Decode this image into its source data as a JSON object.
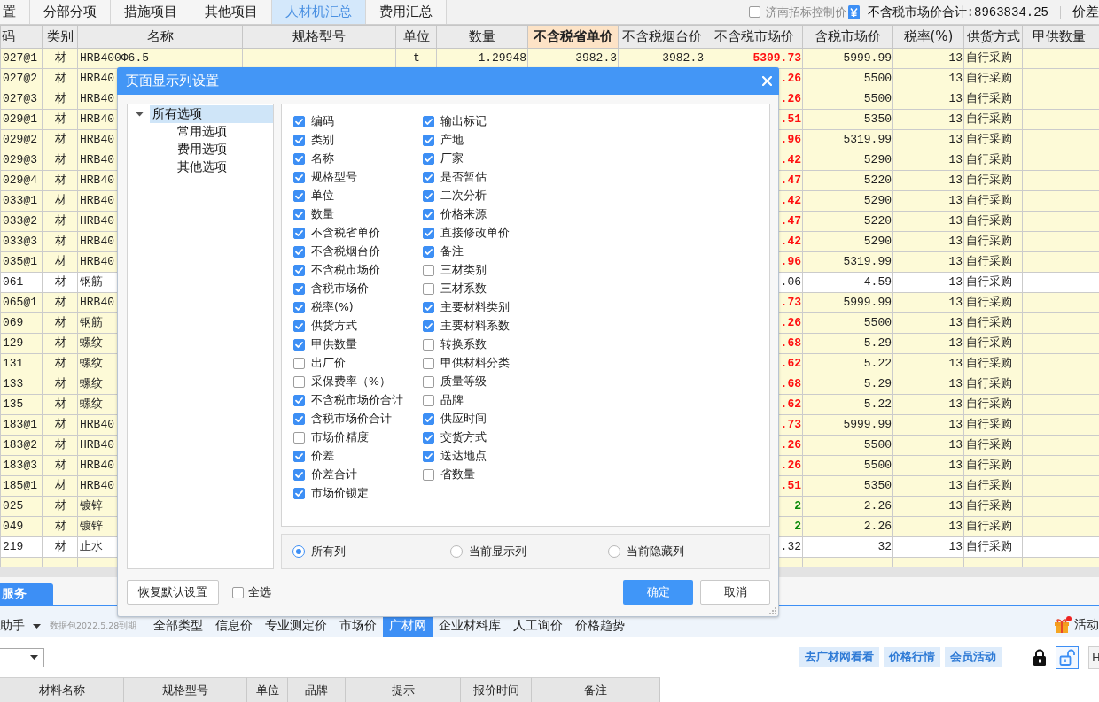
{
  "top_tabs": [
    {
      "label": "置",
      "selected": false
    },
    {
      "label": "分部分项",
      "selected": false
    },
    {
      "label": "措施项目",
      "selected": false
    },
    {
      "label": "其他项目",
      "selected": false
    },
    {
      "label": "人材机汇总",
      "selected": true
    },
    {
      "label": "费用汇总",
      "selected": false
    }
  ],
  "price_control": {
    "label": "济南招标控制价",
    "checked": false
  },
  "market_total": "不含税市场价合计:8963834.25",
  "price_diff": "价差",
  "table": {
    "columns": [
      {
        "label": "码",
        "highlighted": false
      },
      {
        "label": "类别",
        "highlighted": false
      },
      {
        "label": "名称",
        "highlighted": false
      },
      {
        "label": "规格型号",
        "highlighted": false
      },
      {
        "label": "单位",
        "highlighted": false
      },
      {
        "label": "数量",
        "highlighted": false
      },
      {
        "label": "不含税省单价",
        "highlighted": true
      },
      {
        "label": "不含税烟台价",
        "highlighted": false
      },
      {
        "label": "不含税市场价",
        "highlighted": false
      },
      {
        "label": "含税市场价",
        "highlighted": false
      },
      {
        "label": "税率(%)",
        "highlighted": false
      },
      {
        "label": "供货方式",
        "highlighted": false
      },
      {
        "label": "甲供数量",
        "highlighted": false
      }
    ],
    "rows": [
      {
        "kind": "raised",
        "highlighted": true,
        "code": "027@1",
        "type": "材",
        "name": "HRB400Φ6.5",
        "unit": "t",
        "quantity": "1.29948",
        "provincial_price": "3982.3",
        "yantai_price": "3982.3",
        "market_price": "5309.73",
        "market_price_tax": "5999.99",
        "tax_rate": "13",
        "supply": "自行采购"
      },
      {
        "kind": "raised",
        "highlighted": true,
        "code": "027@2",
        "type": "材",
        "name": "HRB40",
        "market_price": ".26",
        "market_price_tax": "5500",
        "tax_rate": "13",
        "supply": "自行采购"
      },
      {
        "kind": "raised",
        "highlighted": true,
        "code": "027@3",
        "type": "材",
        "name": "HRB40",
        "market_price": ".26",
        "market_price_tax": "5500",
        "tax_rate": "13",
        "supply": "自行采购"
      },
      {
        "kind": "raised",
        "highlighted": true,
        "code": "029@1",
        "type": "材",
        "name": "HRB40",
        "market_price": ".51",
        "market_price_tax": "5350",
        "tax_rate": "13",
        "supply": "自行采购"
      },
      {
        "kind": "raised",
        "highlighted": true,
        "code": "029@2",
        "type": "材",
        "name": "HRB40",
        "market_price": ".96",
        "market_price_tax": "5319.99",
        "tax_rate": "13",
        "supply": "自行采购"
      },
      {
        "kind": "raised",
        "highlighted": true,
        "code": "029@3",
        "type": "材",
        "name": "HRB40",
        "market_price": ".42",
        "market_price_tax": "5290",
        "tax_rate": "13",
        "supply": "自行采购"
      },
      {
        "kind": "raised",
        "highlighted": true,
        "code": "029@4",
        "type": "材",
        "name": "HRB40",
        "market_price": ".47",
        "market_price_tax": "5220",
        "tax_rate": "13",
        "supply": "自行采购"
      },
      {
        "kind": "raised",
        "highlighted": true,
        "code": "033@1",
        "type": "材",
        "name": "HRB40",
        "market_price": ".42",
        "market_price_tax": "5290",
        "tax_rate": "13",
        "supply": "自行采购"
      },
      {
        "kind": "raised",
        "highlighted": true,
        "code": "033@2",
        "type": "材",
        "name": "HRB40",
        "market_price": ".47",
        "market_price_tax": "5220",
        "tax_rate": "13",
        "supply": "自行采购"
      },
      {
        "kind": "raised",
        "highlighted": true,
        "code": "033@3",
        "type": "材",
        "name": "HRB40",
        "market_price": ".42",
        "market_price_tax": "5290",
        "tax_rate": "13",
        "supply": "自行采购"
      },
      {
        "kind": "raised",
        "highlighted": true,
        "code": "035@1",
        "type": "材",
        "name": "HRB40",
        "market_price": ".96",
        "market_price_tax": "5319.99",
        "tax_rate": "13",
        "supply": "自行采购"
      },
      {
        "kind": "unchanged",
        "highlighted": false,
        "code": "061",
        "type": "材",
        "name": "钢筋",
        "market_price": ".06",
        "market_price_tax": "4.59",
        "tax_rate": "13",
        "supply": "自行采购"
      },
      {
        "kind": "raised",
        "highlighted": true,
        "code": "065@1",
        "type": "材",
        "name": "HRB40",
        "market_price": ".73",
        "market_price_tax": "5999.99",
        "tax_rate": "13",
        "supply": "自行采购"
      },
      {
        "kind": "raised",
        "highlighted": true,
        "code": "069",
        "type": "材",
        "name": "钢筋",
        "market_price": ".26",
        "market_price_tax": "5500",
        "tax_rate": "13",
        "supply": "自行采购"
      },
      {
        "kind": "raised",
        "highlighted": true,
        "code": "129",
        "type": "材",
        "name": "螺纹",
        "market_price": ".68",
        "market_price_tax": "5.29",
        "tax_rate": "13",
        "supply": "自行采购"
      },
      {
        "kind": "raised",
        "highlighted": true,
        "code": "131",
        "type": "材",
        "name": "螺纹",
        "market_price": ".62",
        "market_price_tax": "5.22",
        "tax_rate": "13",
        "supply": "自行采购"
      },
      {
        "kind": "raised",
        "highlighted": true,
        "code": "133",
        "type": "材",
        "name": "螺纹",
        "market_price": ".68",
        "market_price_tax": "5.29",
        "tax_rate": "13",
        "supply": "自行采购"
      },
      {
        "kind": "raised",
        "highlighted": true,
        "code": "135",
        "type": "材",
        "name": "螺纹",
        "market_price": ".62",
        "market_price_tax": "5.22",
        "tax_rate": "13",
        "supply": "自行采购"
      },
      {
        "kind": "raised",
        "highlighted": true,
        "code": "183@1",
        "type": "材",
        "name": "HRB40",
        "market_price": ".73",
        "market_price_tax": "5999.99",
        "tax_rate": "13",
        "supply": "自行采购"
      },
      {
        "kind": "raised",
        "highlighted": true,
        "code": "183@2",
        "type": "材",
        "name": "HRB40",
        "market_price": ".26",
        "market_price_tax": "5500",
        "tax_rate": "13",
        "supply": "自行采购"
      },
      {
        "kind": "raised",
        "highlighted": true,
        "code": "183@3",
        "type": "材",
        "name": "HRB40",
        "market_price": ".26",
        "market_price_tax": "5500",
        "tax_rate": "13",
        "supply": "自行采购"
      },
      {
        "kind": "raised",
        "highlighted": true,
        "code": "185@1",
        "type": "材",
        "name": "HRB40",
        "market_price": ".51",
        "market_price_tax": "5350",
        "tax_rate": "13",
        "supply": "自行采购"
      },
      {
        "kind": "lowered",
        "highlighted": true,
        "code": "025",
        "type": "材",
        "name": "镀锌",
        "market_price": "2",
        "market_price_tax": "2.26",
        "tax_rate": "13",
        "supply": "自行采购"
      },
      {
        "kind": "lowered",
        "highlighted": true,
        "code": "049",
        "type": "材",
        "name": "镀锌",
        "market_price": "2",
        "market_price_tax": "2.26",
        "tax_rate": "13",
        "supply": "自行采购"
      },
      {
        "kind": "unchanged",
        "highlighted": false,
        "code": "219",
        "type": "材",
        "name": "止水",
        "market_price": ".32",
        "market_price_tax": "32",
        "tax_rate": "13",
        "supply": "自行采购"
      }
    ]
  },
  "bottom_tabs": [
    {
      "label": "服务",
      "selected": true
    }
  ],
  "assistant": {
    "label": "助手",
    "data_expiry": "数据包2022.5.28到期"
  },
  "source_tabs": [
    {
      "label": "全部类型",
      "selected": false
    },
    {
      "label": "信息价",
      "selected": false
    },
    {
      "label": "专业测定价",
      "selected": false
    },
    {
      "label": "市场价",
      "selected": false
    },
    {
      "label": "广材网",
      "selected": true
    },
    {
      "label": "企业材料库",
      "selected": false
    },
    {
      "label": "人工询价",
      "selected": false
    },
    {
      "label": "价格趋势",
      "selected": false
    }
  ],
  "activity": "活动",
  "action_buttons": [
    "去广材网看看",
    "价格行情",
    "会员活动"
  ],
  "lock_modes": [
    {
      "kind": "locked",
      "selected": false
    },
    {
      "kind": "unlocked",
      "selected": true
    }
  ],
  "h_button": "H",
  "lower_table": {
    "columns": [
      "材料名称",
      "规格型号",
      "单位",
      "品牌",
      "提示",
      "报价时间",
      "备注"
    ]
  },
  "dialog": {
    "title": "页面显示列设置",
    "tree": [
      {
        "label": "所有选项",
        "expanded": true,
        "selected": true,
        "children": [
          {
            "label": "常用选项",
            "selected": false
          },
          {
            "label": "费用选项",
            "selected": false
          },
          {
            "label": "其他选项",
            "selected": false
          }
        ]
      }
    ],
    "option_columns": [
      [
        {
          "label": "编码",
          "checked": true
        },
        {
          "label": "类别",
          "checked": true
        },
        {
          "label": "名称",
          "checked": true
        },
        {
          "label": "规格型号",
          "checked": true
        },
        {
          "label": "单位",
          "checked": true
        },
        {
          "label": "数量",
          "checked": true
        },
        {
          "label": "不含税省单价",
          "checked": true
        },
        {
          "label": "不含税烟台价",
          "checked": true
        },
        {
          "label": "不含税市场价",
          "checked": true
        },
        {
          "label": "含税市场价",
          "checked": true
        },
        {
          "label": "税率(%)",
          "checked": true
        },
        {
          "label": "供货方式",
          "checked": true
        },
        {
          "label": "甲供数量",
          "checked": true
        },
        {
          "label": "出厂价",
          "checked": false
        },
        {
          "label": "采保费率（%）",
          "checked": false
        },
        {
          "label": "不含税市场价合计",
          "checked": true
        },
        {
          "label": "含税市场价合计",
          "checked": true
        },
        {
          "label": "市场价精度",
          "checked": false
        },
        {
          "label": "价差",
          "checked": true
        },
        {
          "label": "价差合计",
          "checked": true
        },
        {
          "label": "市场价锁定",
          "checked": true
        }
      ],
      [
        {
          "label": "输出标记",
          "checked": true
        },
        {
          "label": "产地",
          "checked": true
        },
        {
          "label": "厂家",
          "checked": true
        },
        {
          "label": "是否暂估",
          "checked": true
        },
        {
          "label": "二次分析",
          "checked": true
        },
        {
          "label": "价格来源",
          "checked": true
        },
        {
          "label": "直接修改单价",
          "checked": true
        },
        {
          "label": "备注",
          "checked": true
        },
        {
          "label": "三材类别",
          "checked": false
        },
        {
          "label": "三材系数",
          "checked": false
        },
        {
          "label": "主要材料类别",
          "checked": true
        },
        {
          "label": "主要材料系数",
          "checked": true
        },
        {
          "label": "转换系数",
          "checked": false
        },
        {
          "label": "甲供材料分类",
          "checked": false
        },
        {
          "label": "质量等级",
          "checked": false
        },
        {
          "label": "品牌",
          "checked": false
        },
        {
          "label": "供应时间",
          "checked": true
        },
        {
          "label": "交货方式",
          "checked": true
        },
        {
          "label": "送达地点",
          "checked": true
        },
        {
          "label": "省数量",
          "checked": false
        }
      ]
    ],
    "filters": [
      {
        "label": "所有列",
        "selected": true
      },
      {
        "label": "当前显示列",
        "selected": false
      },
      {
        "label": "当前隐藏列",
        "selected": false
      }
    ],
    "reset_button": "恢复默认设置",
    "select_all": {
      "label": "全选",
      "checked": false
    },
    "ok_button": "确定",
    "cancel_button": "取消"
  }
}
